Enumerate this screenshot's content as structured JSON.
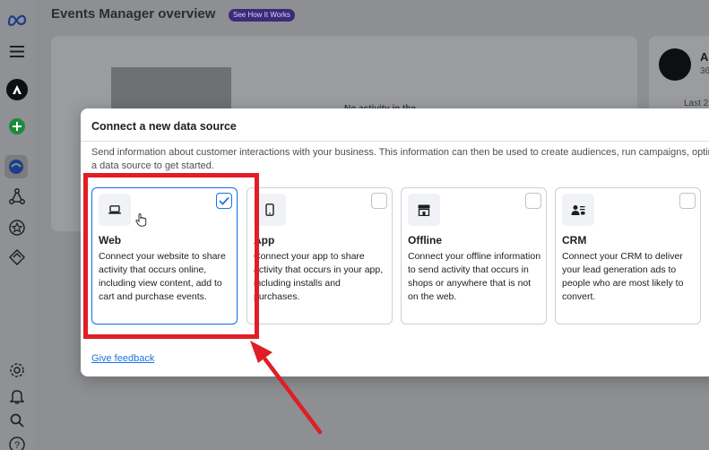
{
  "app": {
    "page_title": "Events Manager overview",
    "badge": "See How It Works",
    "background_text": "No activity in the",
    "account_initial": "A",
    "account_sub": "36",
    "date_range": "Last 2"
  },
  "sidebar": {
    "items": [
      {
        "name": "meta-logo-icon"
      },
      {
        "name": "menu-icon"
      },
      {
        "name": "account-avatar-icon"
      },
      {
        "name": "add-icon"
      },
      {
        "name": "overview-icon"
      },
      {
        "name": "partner-integrations-icon"
      },
      {
        "name": "custom-conversions-icon"
      },
      {
        "name": "data-sources-icon"
      },
      {
        "name": "settings-icon"
      },
      {
        "name": "notifications-icon"
      },
      {
        "name": "search-icon"
      },
      {
        "name": "help-icon"
      }
    ]
  },
  "modal": {
    "title": "Connect a new data source",
    "description": "Send information about customer interactions with your business. This information can then be used to create audiences, run campaigns, optim a data source to get started.",
    "options": [
      {
        "title": "Web",
        "description": "Connect your website to share activity that occurs online, including view content, add to cart and purchase events.",
        "selected": true,
        "icon": "laptop-icon"
      },
      {
        "title": "App",
        "description": "Connect your app to share activity that occurs in your app, including installs and purchases.",
        "selected": false,
        "icon": "mobile-icon"
      },
      {
        "title": "Offline",
        "description": "Connect your offline information to send activity that occurs in shops or anywhere that is not on the web.",
        "selected": false,
        "icon": "store-icon"
      },
      {
        "title": "CRM",
        "description": "Connect your CRM to deliver your lead generation ads to people who are most likely to convert.",
        "selected": false,
        "icon": "crm-people-icon"
      }
    ],
    "feedback_link": "Give feedback"
  },
  "colors": {
    "accent": "#1b74e4",
    "annotation": "#e01e25",
    "overlay": "#8d8f92"
  }
}
